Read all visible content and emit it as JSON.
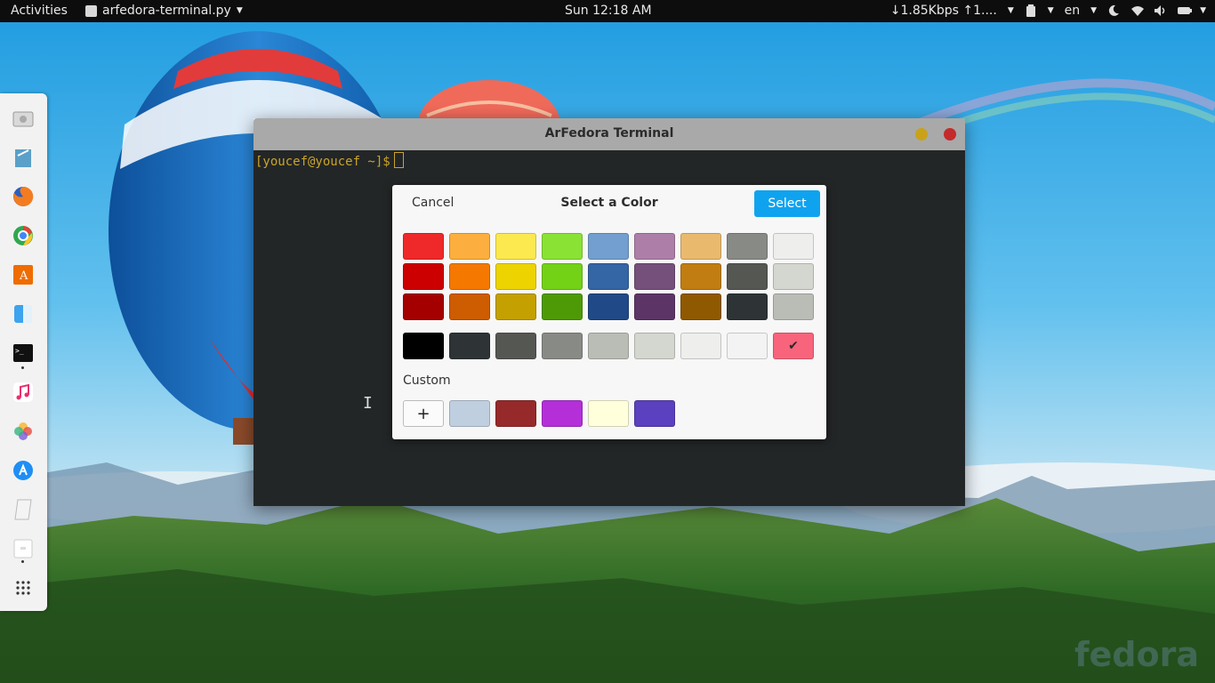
{
  "topbar": {
    "activities": "Activities",
    "app_name": "arfedora-terminal.py",
    "clock": "Sun 12:18 AM",
    "net_speed": "↓1.85Kbps ↑1....",
    "language": "en"
  },
  "dock": {
    "apps": [
      "screenshot-icon",
      "text-editor-icon",
      "firefox-icon",
      "chrome-icon",
      "arduino-icon",
      "files-icon",
      "terminal-icon",
      "music-icon",
      "photos-icon",
      "app-store-icon",
      "notes-icon",
      "document-icon",
      "show-apps-icon"
    ]
  },
  "terminal": {
    "title": "ArFedora Terminal",
    "prompt": "[youcef@youcef ~]$"
  },
  "dialog": {
    "cancel": "Cancel",
    "title": "Select a Color",
    "select": "Select",
    "custom_label": "Custom",
    "add_label": "+",
    "selected_mark": "✔",
    "palette": [
      [
        "#ef2929",
        "#fcaf3e",
        "#fce94f",
        "#8ae234",
        "#729fcf",
        "#ad7fa8",
        "#e9b96e",
        "#888a85",
        "#eeeeec"
      ],
      [
        "#cc0000",
        "#f57900",
        "#edd400",
        "#73d216",
        "#3465a4",
        "#75507b",
        "#c17d11",
        "#555753",
        "#d3d7cf"
      ],
      [
        "#a40000",
        "#ce5c00",
        "#c4a000",
        "#4e9a06",
        "#204a87",
        "#5c3566",
        "#8f5902",
        "#2e3436",
        "#babdb6"
      ]
    ],
    "greys": [
      "#000000",
      "#2e3436",
      "#555753",
      "#888a85",
      "#babdb6",
      "#d3d7cf",
      "#eeeeec",
      "#f3f3f3",
      "#f7647b"
    ],
    "selected_color": "#f7647b",
    "custom_colors": [
      "#c0cfe0",
      "#962a2a",
      "#b42fd8",
      "#ffffdc",
      "#5b40bf"
    ]
  },
  "wallpaper": {
    "watermark": "fedora"
  }
}
